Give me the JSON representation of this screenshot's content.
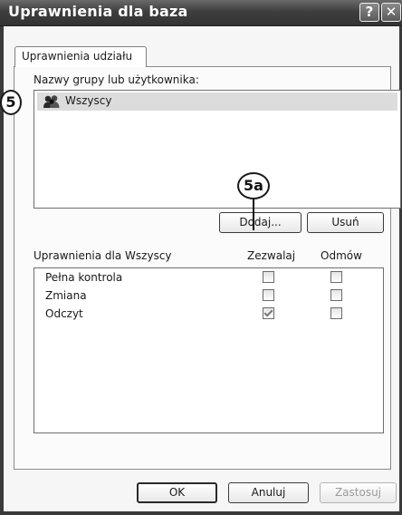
{
  "window": {
    "title": "Uprawnienia dla baza",
    "help_glyph": "?",
    "close_glyph": "✕"
  },
  "tabs": [
    {
      "label": "Uprawnienia udziału",
      "active": true
    }
  ],
  "groups": {
    "label": "Nazwy grupy lub użytkownika:",
    "items": [
      {
        "name": "Wszyscy",
        "icon": "user-group-icon",
        "selected": true
      }
    ]
  },
  "group_buttons": {
    "add": "Dodaj...",
    "remove": "Usuń"
  },
  "permissions": {
    "header": "Uprawnienia dla Wszyscy",
    "allow_header": "Zezwalaj",
    "deny_header": "Odmów",
    "rows": [
      {
        "label": "Pełna kontrola",
        "allow": false,
        "deny": false
      },
      {
        "label": "Zmiana",
        "allow": false,
        "deny": false
      },
      {
        "label": "Odczyt",
        "allow": true,
        "deny": false
      }
    ]
  },
  "dialog_buttons": {
    "ok": "OK",
    "cancel": "Anuluj",
    "apply": "Zastosuj",
    "apply_enabled": false
  },
  "annotations": [
    {
      "label": "5"
    },
    {
      "label": "5a"
    }
  ]
}
